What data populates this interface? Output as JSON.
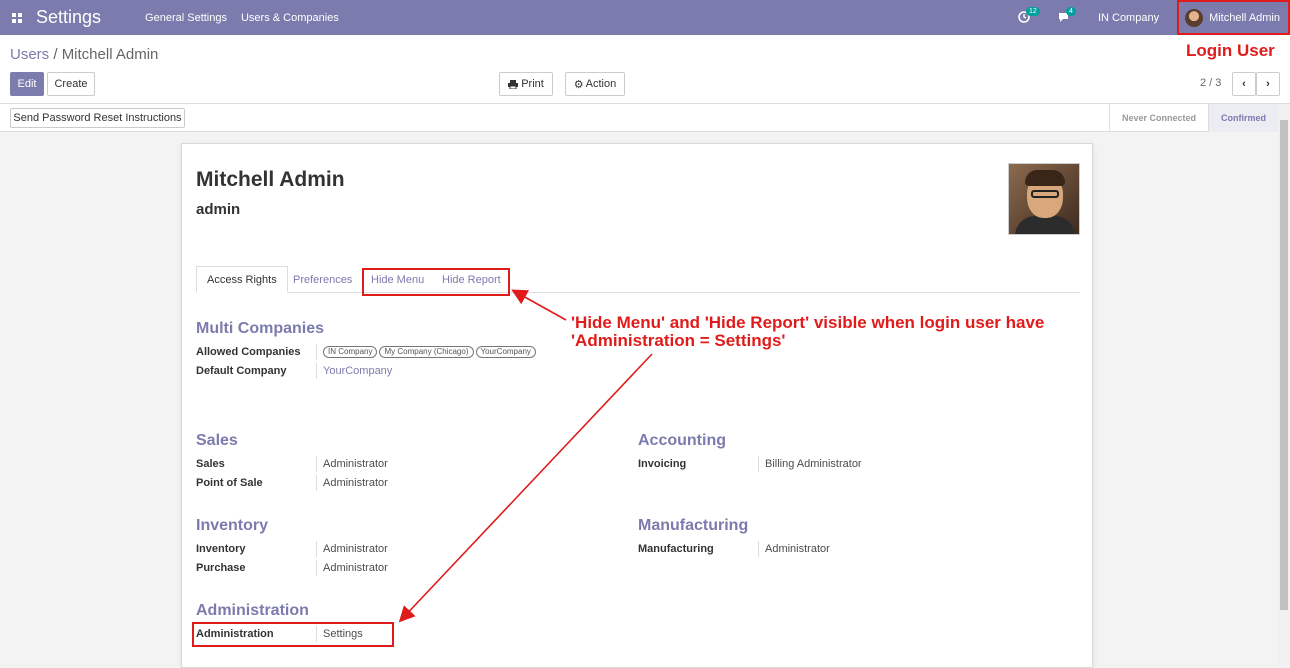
{
  "navbar": {
    "app_title": "Settings",
    "menu": [
      "General Settings",
      "Users & Companies"
    ],
    "activity_count": "12",
    "message_count": "4",
    "company": "IN Company",
    "user": "Mitchell Admin"
  },
  "annotations": {
    "login_user": "Login User",
    "note": "'Hide Menu' and 'Hide Report' visible when login user have 'Administration = Settings'",
    "highlight_color": "#e01b1b"
  },
  "control_panel": {
    "breadcrumb_parent": "Users",
    "breadcrumb_sep": "/",
    "breadcrumb_current": "Mitchell Admin",
    "edit_label": "Edit",
    "create_label": "Create",
    "print_label": "Print",
    "action_label": "Action",
    "pager": "2 / 3"
  },
  "statusbar": {
    "reset_button": "Send Password Reset Instructions",
    "stages": [
      "Never Connected",
      "Confirmed"
    ]
  },
  "form": {
    "name": "Mitchell Admin",
    "login": "admin",
    "tabs": [
      "Access Rights",
      "Preferences",
      "Hide Menu",
      "Hide Report"
    ],
    "multi_companies": {
      "title": "Multi Companies",
      "allowed_label": "Allowed Companies",
      "allowed": [
        "IN Company",
        "My Company (Chicago)",
        "YourCompany"
      ],
      "default_label": "Default Company",
      "default": "YourCompany"
    },
    "sales": {
      "title": "Sales",
      "rows": [
        {
          "label": "Sales",
          "value": "Administrator"
        },
        {
          "label": "Point of Sale",
          "value": "Administrator"
        }
      ]
    },
    "accounting": {
      "title": "Accounting",
      "rows": [
        {
          "label": "Invoicing",
          "value": "Billing Administrator"
        }
      ]
    },
    "inventory": {
      "title": "Inventory",
      "rows": [
        {
          "label": "Inventory",
          "value": "Administrator"
        },
        {
          "label": "Purchase",
          "value": "Administrator"
        }
      ]
    },
    "manufacturing": {
      "title": "Manufacturing",
      "rows": [
        {
          "label": "Manufacturing",
          "value": "Administrator"
        }
      ]
    },
    "administration": {
      "title": "Administration",
      "rows": [
        {
          "label": "Administration",
          "value": "Settings"
        }
      ]
    }
  },
  "colors": {
    "brand": "#7c7bad",
    "badge": "#00a09d"
  }
}
